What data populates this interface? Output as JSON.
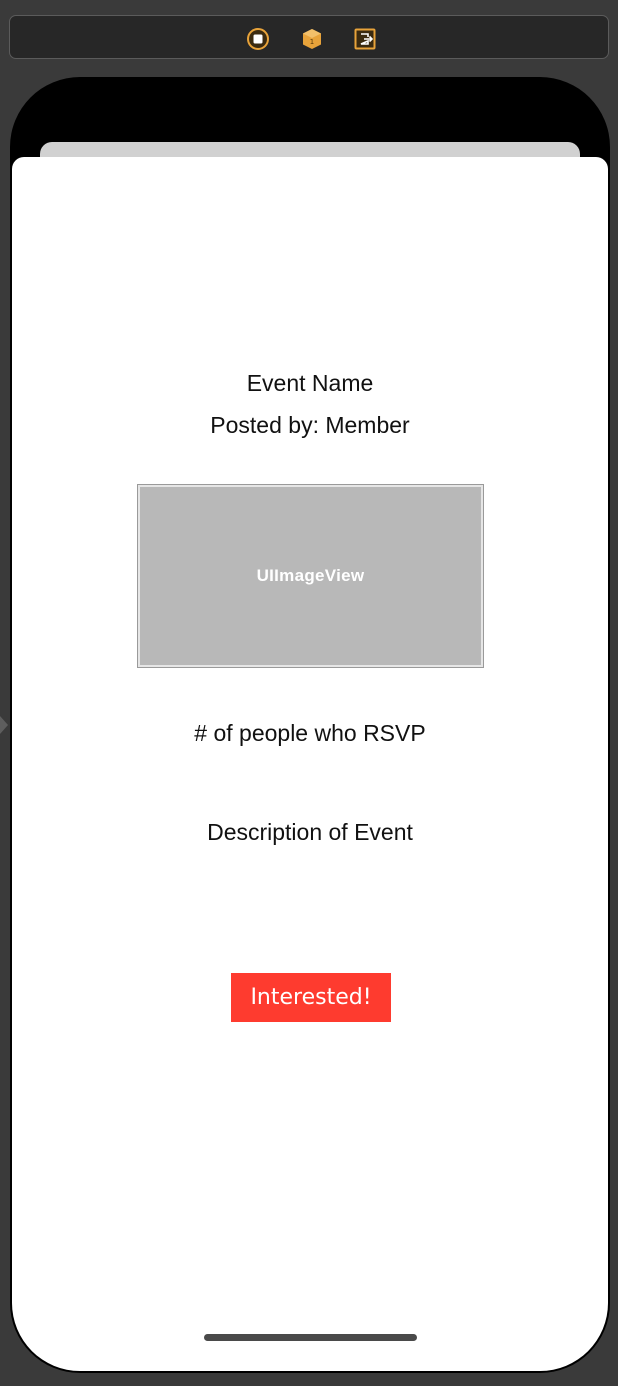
{
  "toolbar": {
    "icons": [
      "view-controller-icon",
      "first-responder-icon",
      "exit-icon"
    ],
    "icon_color": "#e8a33a"
  },
  "screen": {
    "event_name": "Event Name",
    "posted_by": "Posted by: Member",
    "image_placeholder": "UIImageView",
    "rsvp_count": "# of people who RSVP",
    "description": "Description of Event",
    "interested_button": "Interested!"
  },
  "colors": {
    "button_background": "#fe3b2f",
    "button_text": "#ffffff",
    "image_placeholder_background": "#b8b8b8",
    "canvas_background": "#3a3a3a"
  }
}
